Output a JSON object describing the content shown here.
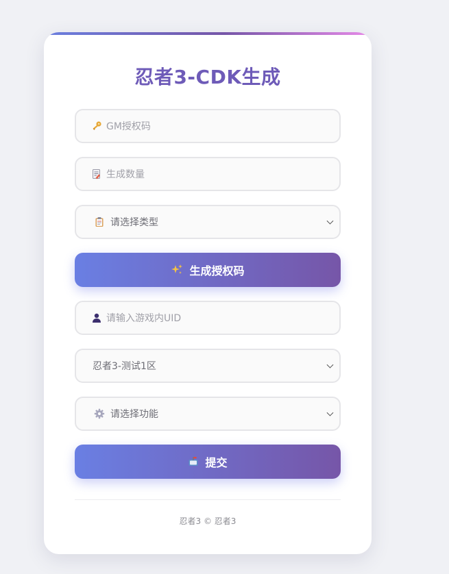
{
  "title": "忍者3-CDK生成",
  "colors": {
    "accent": "#6e5bb8",
    "gradient_start": "#6a7fe3",
    "gradient_end": "#7656a8",
    "page_background": "#f0f1f5"
  },
  "gm_code": {
    "placeholder": "GM授权码",
    "value": "",
    "icon": "key-icon"
  },
  "quantity": {
    "placeholder": "生成数量",
    "value": "",
    "icon": "memo-icon"
  },
  "type_select": {
    "selected": "请选择类型",
    "icon": "clipboard-icon"
  },
  "generate_button": {
    "label": "生成授权码",
    "icon": "sparkles-icon"
  },
  "uid": {
    "placeholder": "请输入游戏内UID",
    "value": "",
    "icon": "user-icon"
  },
  "server_select": {
    "selected": "忍者3-测试1区"
  },
  "function_select": {
    "selected": "请选择功能",
    "icon": "gear-icon"
  },
  "submit_button": {
    "label": "提交",
    "icon": "mailbox-icon"
  },
  "footer": {
    "text": "忍者3 © 忍者3"
  }
}
